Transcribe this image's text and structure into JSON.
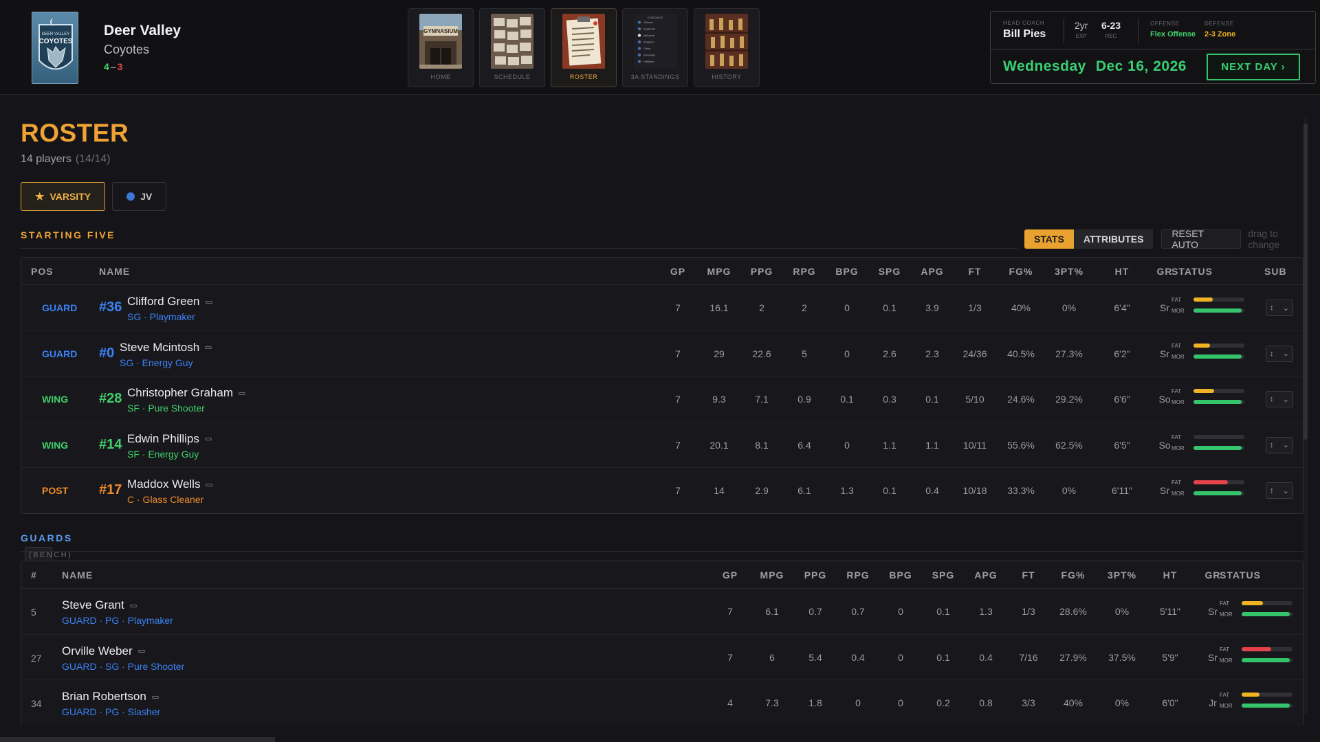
{
  "header": {
    "team_city": "Deer Valley",
    "team_name": "Coyotes",
    "record_w": "4",
    "record_sep": "–",
    "record_l": "3",
    "logo_text": "DEER VALLEY COYOTES",
    "nav": [
      {
        "label": "HOME",
        "icon": "gymnasium-icon"
      },
      {
        "label": "SCHEDULE",
        "icon": "schedule-board-icon"
      },
      {
        "label": "ROSTER",
        "icon": "clipboard-icon"
      },
      {
        "label": "3A STANDINGS",
        "icon": "standings-icon"
      },
      {
        "label": "HISTORY",
        "icon": "trophy-case-icon"
      }
    ],
    "active_nav": "ROSTER",
    "gym_sign": "GYMNASIUM",
    "standings_title": "STANDINGS",
    "standings_teams": [
      "Gilmore",
      "Redlands",
      "Millcreek",
      "Kingston",
      "Oxley",
      "Riverdale",
      "Halliburn"
    ],
    "coach": {
      "head_coach_label": "HEAD COACH",
      "name": "Bill Pies",
      "exp_value": "2yr",
      "exp_label": "EXP",
      "rec_value": "6-23",
      "rec_label": "REC",
      "offense_label": "OFFENSE",
      "offense": "Flex Offense",
      "defense_label": "DEFENSE",
      "defense": "2-3 Zone",
      "day": "Wednesday",
      "date": "Dec 16, 2026",
      "next_day": "NEXT DAY ›"
    }
  },
  "page": {
    "title": "ROSTER",
    "player_count": "14 players",
    "capacity": "(14/14)",
    "tabs": [
      {
        "label": "VARSITY",
        "icon": "star-icon",
        "active": true
      },
      {
        "label": "JV",
        "icon": "jv-dot-icon",
        "active": false
      }
    ],
    "starting_title": "STARTING FIVE",
    "view_toggle": {
      "stats": "STATS",
      "attributes": "ATTRIBUTES",
      "reset": "RESET AUTO",
      "hint": "drag to change"
    },
    "bench_title": "GUARDS",
    "bench_sub": "(BENCH)"
  },
  "colors": {
    "accent": "#f0a234",
    "guard": "#3b82f6",
    "wing": "#3fcf6a",
    "post": "#f08a2c",
    "fat_yellow": "#f0b323",
    "fat_red": "#e5434a",
    "morale_green": "#35c46b"
  },
  "starters_columns": [
    "POS",
    "NAME",
    "GP",
    "MPG",
    "PPG",
    "RPG",
    "BPG",
    "SPG",
    "APG",
    "FT",
    "FG%",
    "3PT%",
    "HT",
    "GR",
    "STATUS",
    "SUB"
  ],
  "starters": [
    {
      "pos": "GUARD",
      "num": "#36",
      "name": "Clifford Green",
      "role": "SG · Playmaker",
      "gp": "7",
      "mpg": "16.1",
      "ppg": "2",
      "rpg": "2",
      "bpg": "0",
      "spg": "0.1",
      "apg": "3.9",
      "ft": "1/3",
      "fg": "40%",
      "tp": "0%",
      "ht": "6'4\"",
      "gr": "Sr",
      "fat": 0.38,
      "fat_color": "yellow",
      "mor": 0.95,
      "fat_label": "FAT",
      "mor_label": "MOR",
      "sub": "↕"
    },
    {
      "pos": "GUARD",
      "num": "#0",
      "name": "Steve Mcintosh",
      "role": "SG · Energy Guy",
      "gp": "7",
      "mpg": "29",
      "ppg": "22.6",
      "rpg": "5",
      "bpg": "0",
      "spg": "2.6",
      "apg": "2.3",
      "ft": "24/36",
      "fg": "40.5%",
      "tp": "27.3%",
      "ht": "6'2\"",
      "gr": "Sr",
      "fat": 0.32,
      "fat_color": "yellow",
      "mor": 0.95,
      "fat_label": "FAT",
      "mor_label": "MOR",
      "sub": "↕"
    },
    {
      "pos": "WING",
      "num": "#28",
      "name": "Christopher Graham",
      "role": "SF · Pure Shooter",
      "gp": "7",
      "mpg": "9.3",
      "ppg": "7.1",
      "rpg": "0.9",
      "bpg": "0.1",
      "spg": "0.3",
      "apg": "0.1",
      "ft": "5/10",
      "fg": "24.6%",
      "tp": "29.2%",
      "ht": "6'6\"",
      "gr": "So",
      "fat": 0.4,
      "fat_color": "yellow",
      "mor": 0.95,
      "fat_label": "FAT",
      "mor_label": "MOR",
      "sub": "↕"
    },
    {
      "pos": "WING",
      "num": "#14",
      "name": "Edwin Phillips",
      "role": "SF · Energy Guy",
      "gp": "7",
      "mpg": "20.1",
      "ppg": "8.1",
      "rpg": "6.4",
      "bpg": "0",
      "spg": "1.1",
      "apg": "1.1",
      "ft": "10/11",
      "fg": "55.6%",
      "tp": "62.5%",
      "ht": "6'5\"",
      "gr": "So",
      "fat": 0,
      "fat_color": "yellow",
      "mor": 0.95,
      "fat_label": "FAT",
      "mor_label": "MOR",
      "sub": "↕"
    },
    {
      "pos": "POST",
      "num": "#17",
      "name": "Maddox Wells",
      "role": "C · Glass Cleaner",
      "gp": "7",
      "mpg": "14",
      "ppg": "2.9",
      "rpg": "6.1",
      "bpg": "1.3",
      "spg": "0.1",
      "apg": "0.4",
      "ft": "10/18",
      "fg": "33.3%",
      "tp": "0%",
      "ht": "6'11\"",
      "gr": "Sr",
      "fat": 0.68,
      "fat_color": "red",
      "mor": 0.95,
      "fat_label": "FAT",
      "mor_label": "MOR",
      "sub": "↕"
    }
  ],
  "bench_columns": [
    "#",
    "NAME",
    "GP",
    "MPG",
    "PPG",
    "RPG",
    "BPG",
    "SPG",
    "APG",
    "FT",
    "FG%",
    "3PT%",
    "HT",
    "GR",
    "STATUS"
  ],
  "bench": [
    {
      "num": "5",
      "name": "Steve Grant",
      "role": "GUARD · PG · Playmaker",
      "gp": "7",
      "mpg": "6.1",
      "ppg": "0.7",
      "rpg": "0.7",
      "bpg": "0",
      "spg": "0.1",
      "apg": "1.3",
      "ft": "1/3",
      "fg": "28.6%",
      "tp": "0%",
      "ht": "5'11\"",
      "gr": "Sr",
      "fat": 0.42,
      "fat_color": "yellow",
      "mor": 0.95,
      "fat_label": "FAT",
      "mor_label": "MOR"
    },
    {
      "num": "27",
      "name": "Orville Weber",
      "role": "GUARD · SG · Pure Shooter",
      "gp": "7",
      "mpg": "6",
      "ppg": "5.4",
      "rpg": "0.4",
      "bpg": "0",
      "spg": "0.1",
      "apg": "0.4",
      "ft": "7/16",
      "fg": "27.9%",
      "tp": "37.5%",
      "ht": "5'9\"",
      "gr": "Sr",
      "fat": 0.58,
      "fat_color": "red",
      "mor": 0.95,
      "fat_label": "FAT",
      "mor_label": "MOR"
    },
    {
      "num": "34",
      "name": "Brian Robertson",
      "role": "GUARD · PG · Slasher",
      "gp": "4",
      "mpg": "7.3",
      "ppg": "1.8",
      "rpg": "0",
      "bpg": "0",
      "spg": "0.2",
      "apg": "0.8",
      "ft": "3/3",
      "fg": "40%",
      "tp": "0%",
      "ht": "6'0\"",
      "gr": "Jr",
      "fat": 0.35,
      "fat_color": "yellow",
      "mor": 0.95,
      "fat_label": "FAT",
      "mor_label": "MOR"
    }
  ]
}
